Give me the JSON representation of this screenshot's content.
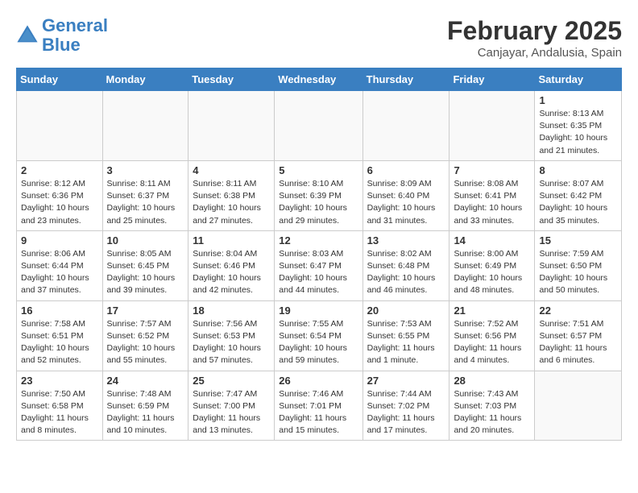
{
  "header": {
    "logo_line1": "General",
    "logo_line2": "Blue",
    "month": "February 2025",
    "location": "Canjayar, Andalusia, Spain"
  },
  "weekdays": [
    "Sunday",
    "Monday",
    "Tuesday",
    "Wednesday",
    "Thursday",
    "Friday",
    "Saturday"
  ],
  "weeks": [
    [
      {
        "day": "",
        "info": ""
      },
      {
        "day": "",
        "info": ""
      },
      {
        "day": "",
        "info": ""
      },
      {
        "day": "",
        "info": ""
      },
      {
        "day": "",
        "info": ""
      },
      {
        "day": "",
        "info": ""
      },
      {
        "day": "1",
        "info": "Sunrise: 8:13 AM\nSunset: 6:35 PM\nDaylight: 10 hours\nand 21 minutes."
      }
    ],
    [
      {
        "day": "2",
        "info": "Sunrise: 8:12 AM\nSunset: 6:36 PM\nDaylight: 10 hours\nand 23 minutes."
      },
      {
        "day": "3",
        "info": "Sunrise: 8:11 AM\nSunset: 6:37 PM\nDaylight: 10 hours\nand 25 minutes."
      },
      {
        "day": "4",
        "info": "Sunrise: 8:11 AM\nSunset: 6:38 PM\nDaylight: 10 hours\nand 27 minutes."
      },
      {
        "day": "5",
        "info": "Sunrise: 8:10 AM\nSunset: 6:39 PM\nDaylight: 10 hours\nand 29 minutes."
      },
      {
        "day": "6",
        "info": "Sunrise: 8:09 AM\nSunset: 6:40 PM\nDaylight: 10 hours\nand 31 minutes."
      },
      {
        "day": "7",
        "info": "Sunrise: 8:08 AM\nSunset: 6:41 PM\nDaylight: 10 hours\nand 33 minutes."
      },
      {
        "day": "8",
        "info": "Sunrise: 8:07 AM\nSunset: 6:42 PM\nDaylight: 10 hours\nand 35 minutes."
      }
    ],
    [
      {
        "day": "9",
        "info": "Sunrise: 8:06 AM\nSunset: 6:44 PM\nDaylight: 10 hours\nand 37 minutes."
      },
      {
        "day": "10",
        "info": "Sunrise: 8:05 AM\nSunset: 6:45 PM\nDaylight: 10 hours\nand 39 minutes."
      },
      {
        "day": "11",
        "info": "Sunrise: 8:04 AM\nSunset: 6:46 PM\nDaylight: 10 hours\nand 42 minutes."
      },
      {
        "day": "12",
        "info": "Sunrise: 8:03 AM\nSunset: 6:47 PM\nDaylight: 10 hours\nand 44 minutes."
      },
      {
        "day": "13",
        "info": "Sunrise: 8:02 AM\nSunset: 6:48 PM\nDaylight: 10 hours\nand 46 minutes."
      },
      {
        "day": "14",
        "info": "Sunrise: 8:00 AM\nSunset: 6:49 PM\nDaylight: 10 hours\nand 48 minutes."
      },
      {
        "day": "15",
        "info": "Sunrise: 7:59 AM\nSunset: 6:50 PM\nDaylight: 10 hours\nand 50 minutes."
      }
    ],
    [
      {
        "day": "16",
        "info": "Sunrise: 7:58 AM\nSunset: 6:51 PM\nDaylight: 10 hours\nand 52 minutes."
      },
      {
        "day": "17",
        "info": "Sunrise: 7:57 AM\nSunset: 6:52 PM\nDaylight: 10 hours\nand 55 minutes."
      },
      {
        "day": "18",
        "info": "Sunrise: 7:56 AM\nSunset: 6:53 PM\nDaylight: 10 hours\nand 57 minutes."
      },
      {
        "day": "19",
        "info": "Sunrise: 7:55 AM\nSunset: 6:54 PM\nDaylight: 10 hours\nand 59 minutes."
      },
      {
        "day": "20",
        "info": "Sunrise: 7:53 AM\nSunset: 6:55 PM\nDaylight: 11 hours\nand 1 minute."
      },
      {
        "day": "21",
        "info": "Sunrise: 7:52 AM\nSunset: 6:56 PM\nDaylight: 11 hours\nand 4 minutes."
      },
      {
        "day": "22",
        "info": "Sunrise: 7:51 AM\nSunset: 6:57 PM\nDaylight: 11 hours\nand 6 minutes."
      }
    ],
    [
      {
        "day": "23",
        "info": "Sunrise: 7:50 AM\nSunset: 6:58 PM\nDaylight: 11 hours\nand 8 minutes."
      },
      {
        "day": "24",
        "info": "Sunrise: 7:48 AM\nSunset: 6:59 PM\nDaylight: 11 hours\nand 10 minutes."
      },
      {
        "day": "25",
        "info": "Sunrise: 7:47 AM\nSunset: 7:00 PM\nDaylight: 11 hours\nand 13 minutes."
      },
      {
        "day": "26",
        "info": "Sunrise: 7:46 AM\nSunset: 7:01 PM\nDaylight: 11 hours\nand 15 minutes."
      },
      {
        "day": "27",
        "info": "Sunrise: 7:44 AM\nSunset: 7:02 PM\nDaylight: 11 hours\nand 17 minutes."
      },
      {
        "day": "28",
        "info": "Sunrise: 7:43 AM\nSunset: 7:03 PM\nDaylight: 11 hours\nand 20 minutes."
      },
      {
        "day": "",
        "info": ""
      }
    ]
  ]
}
